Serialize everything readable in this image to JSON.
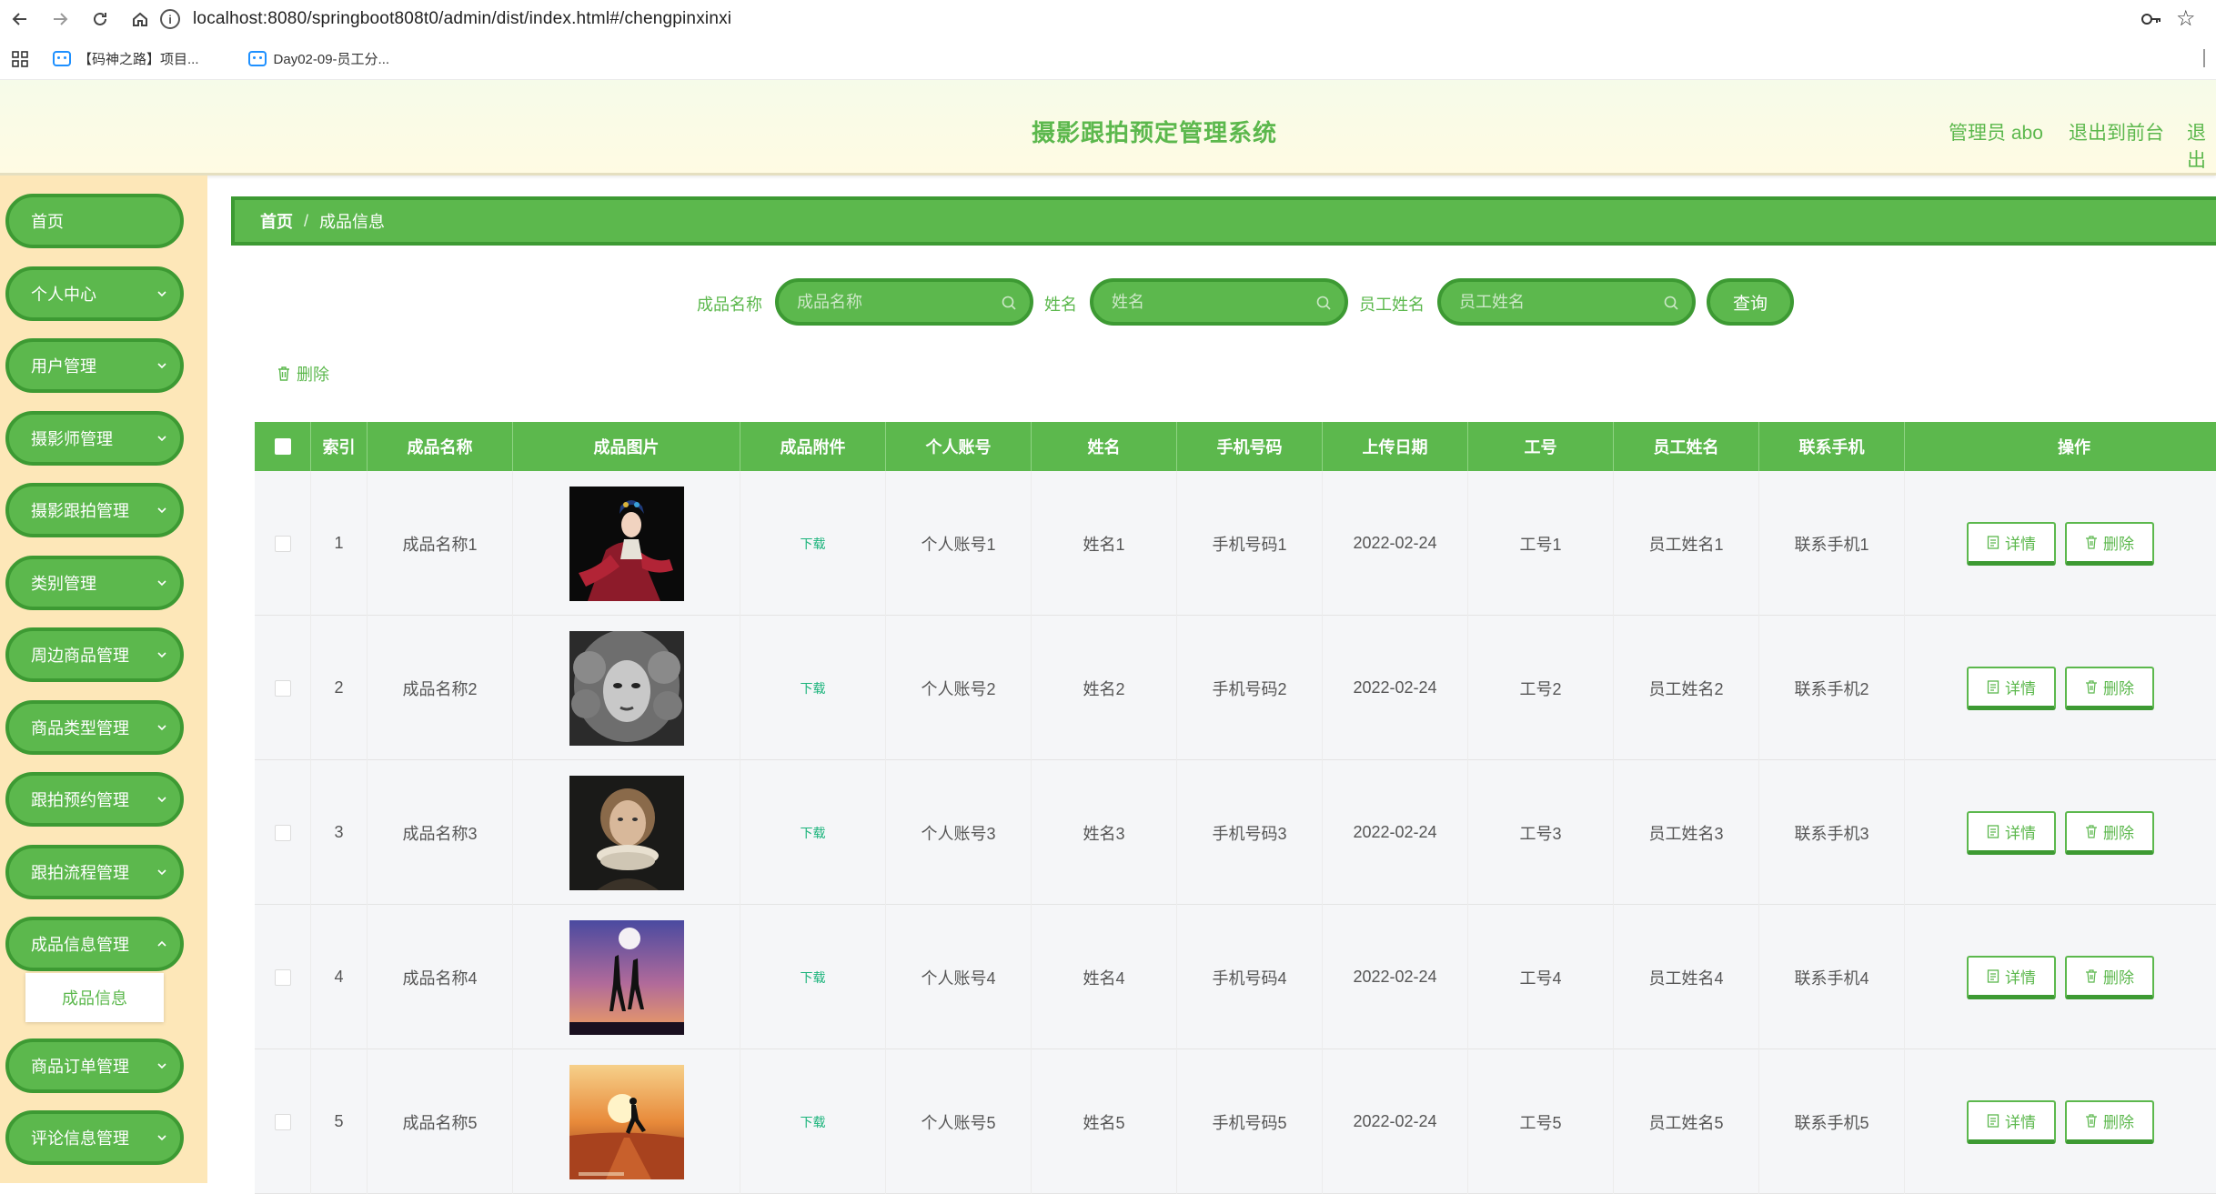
{
  "browser": {
    "url": "localhost:8080/springboot808t0/admin/dist/index.html#/chengpinxinxi",
    "bookmarks": [
      "【码神之路】项目...",
      "Day02-09-员工分..."
    ]
  },
  "header": {
    "title": "摄影跟拍预定管理系统",
    "user_label": "管理员 abo",
    "to_front_label": "退出到前台",
    "logout_label": "退出"
  },
  "sidebar": {
    "items": [
      {
        "label": "首页",
        "has_arrow": false
      },
      {
        "label": "个人中心",
        "has_arrow": true
      },
      {
        "label": "用户管理",
        "has_arrow": true
      },
      {
        "label": "摄影师管理",
        "has_arrow": true
      },
      {
        "label": "摄影跟拍管理",
        "has_arrow": true
      },
      {
        "label": "类别管理",
        "has_arrow": true
      },
      {
        "label": "周边商品管理",
        "has_arrow": true
      },
      {
        "label": "商品类型管理",
        "has_arrow": true
      },
      {
        "label": "跟拍预约管理",
        "has_arrow": true
      },
      {
        "label": "跟拍流程管理",
        "has_arrow": true
      },
      {
        "label": "成品信息管理",
        "has_arrow": true
      },
      {
        "label": "商品订单管理",
        "has_arrow": true
      },
      {
        "label": "评论信息管理",
        "has_arrow": true
      }
    ],
    "active_submenu": "成品信息"
  },
  "breadcrumb": {
    "home": "首页",
    "separator": "/",
    "current": "成品信息"
  },
  "search": {
    "fields": [
      {
        "label": "成品名称",
        "placeholder": "成品名称"
      },
      {
        "label": "姓名",
        "placeholder": "姓名"
      },
      {
        "label": "员工姓名",
        "placeholder": "员工姓名"
      }
    ],
    "query_label": "查询"
  },
  "toolbar": {
    "delete_label": "删除"
  },
  "table": {
    "columns": [
      "索引",
      "成品名称",
      "成品图片",
      "成品附件",
      "个人账号",
      "姓名",
      "手机号码",
      "上传日期",
      "工号",
      "员工姓名",
      "联系手机",
      "操作"
    ],
    "rows": [
      {
        "index": "1",
        "name": "成品名称1",
        "image": "peking-opera-performer",
        "attachment": "下载",
        "account": "个人账号1",
        "realname": "姓名1",
        "phone": "手机号码1",
        "date": "2022-02-24",
        "empno": "工号1",
        "empname": "员工姓名1",
        "contact": "联系手机1"
      },
      {
        "index": "2",
        "name": "成品名称2",
        "image": "black-white-portrait-woman",
        "attachment": "下载",
        "account": "个人账号2",
        "realname": "姓名2",
        "phone": "手机号码2",
        "date": "2022-02-24",
        "empno": "工号2",
        "empname": "员工姓名2",
        "contact": "联系手机2"
      },
      {
        "index": "3",
        "name": "成品名称3",
        "image": "girl-with-ruff-collar",
        "attachment": "下载",
        "account": "个人账号3",
        "realname": "姓名3",
        "phone": "手机号码3",
        "date": "2022-02-24",
        "empno": "工号3",
        "empname": "员工姓名3",
        "contact": "联系手机3"
      },
      {
        "index": "4",
        "name": "成品名称4",
        "image": "silhouettes-under-moon",
        "attachment": "下载",
        "account": "个人账号4",
        "realname": "姓名4",
        "phone": "手机号码4",
        "date": "2022-02-24",
        "empno": "工号4",
        "empname": "员工姓名4",
        "contact": "联系手机4"
      },
      {
        "index": "5",
        "name": "成品名称5",
        "image": "runner-at-sunset",
        "attachment": "下载",
        "account": "个人账号5",
        "realname": "姓名5",
        "phone": "手机号码5",
        "date": "2022-02-24",
        "empno": "工号5",
        "empname": "员工姓名5",
        "contact": "联系手机5"
      }
    ],
    "detail_label": "详情",
    "delete_label": "删除"
  },
  "colors": {
    "primary": "#5cb84d",
    "primary_dark": "#3d9a33",
    "sidebar_bg": "#fde7b8",
    "header_bg": "#fffbe3",
    "link_green": "#19b37a"
  }
}
